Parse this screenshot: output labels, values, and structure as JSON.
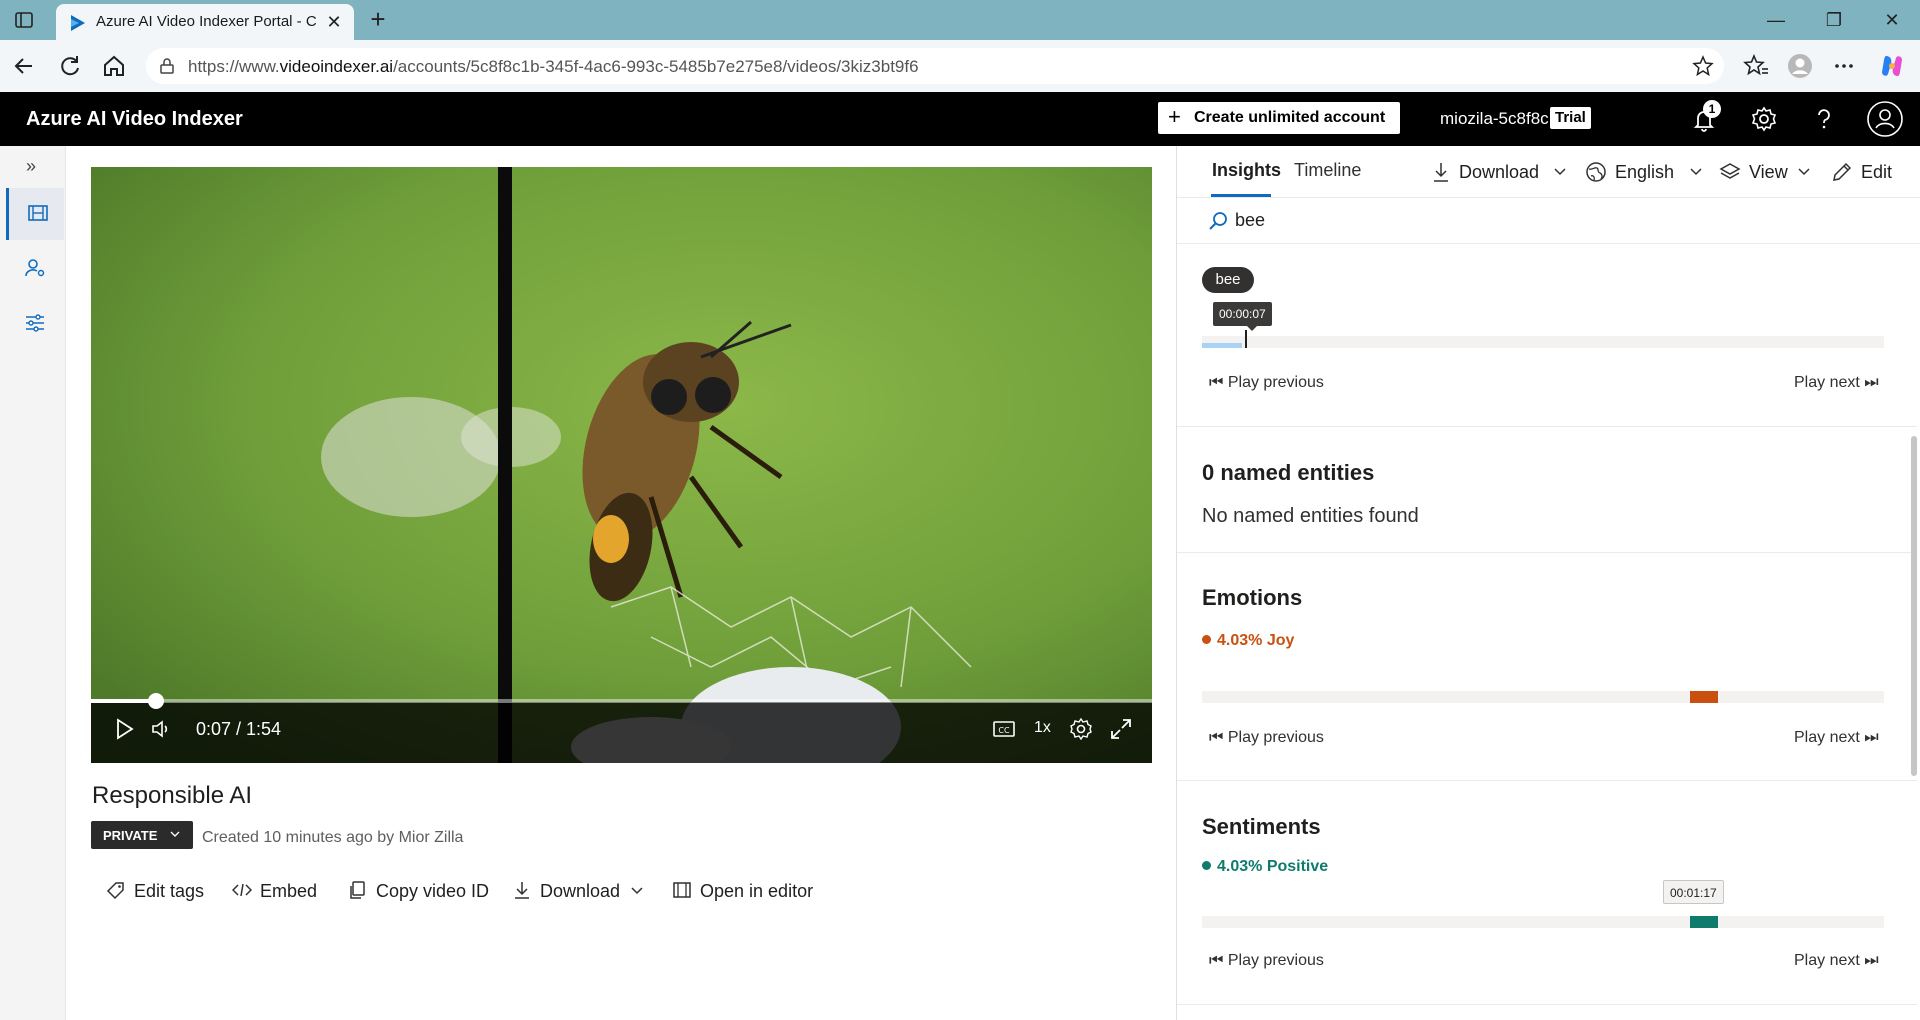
{
  "browser": {
    "tab_title": "Azure AI Video Indexer Portal - Co",
    "url_prefix": "https://www.",
    "url_domain": "videoindexer.ai",
    "url_path": "/accounts/5c8f8c1b-345f-4ac6-993c-5485b7e275e8/videos/3kiz3bt9f6"
  },
  "header": {
    "brand": "Azure AI Video Indexer",
    "create_label": "Create unlimited account",
    "account": "miozila-5c8f8c",
    "trial": "Trial",
    "notification_count": "1"
  },
  "player": {
    "time": "0:07 / 1:54",
    "speed": "1x",
    "progress_fraction": 0.0614
  },
  "video": {
    "title": "Responsible AI",
    "privacy": "PRIVATE",
    "created": "Created 10 minutes ago by Mior Zilla",
    "actions": {
      "edit_tags": "Edit tags",
      "embed": "Embed",
      "copy_id": "Copy video ID",
      "download": "Download",
      "open_editor": "Open in editor"
    }
  },
  "panel": {
    "tabs": {
      "insights": "Insights",
      "timeline": "Timeline"
    },
    "menu": {
      "download": "Download",
      "language": "English",
      "view": "View",
      "edit": "Edit"
    },
    "search_value": "bee",
    "keyword": {
      "chip": "bee",
      "tooltip": "00:00:07",
      "play_previous": "Play previous",
      "play_next": "Play next"
    },
    "named_entities": {
      "title": "0 named entities",
      "empty": "No named entities found"
    },
    "emotions": {
      "title": "Emotions",
      "label": "4.03% Joy",
      "color": "#ca5010",
      "play_previous": "Play previous",
      "play_next": "Play next"
    },
    "sentiments": {
      "title": "Sentiments",
      "label": "4.03% Positive",
      "color": "#0f7b6c",
      "tooltip": "00:01:17",
      "play_previous": "Play previous",
      "play_next": "Play next"
    }
  },
  "colors": {
    "accent": "#0f6cbd",
    "header_bg": "#000000",
    "browser_frame": "#7fb3c0"
  }
}
